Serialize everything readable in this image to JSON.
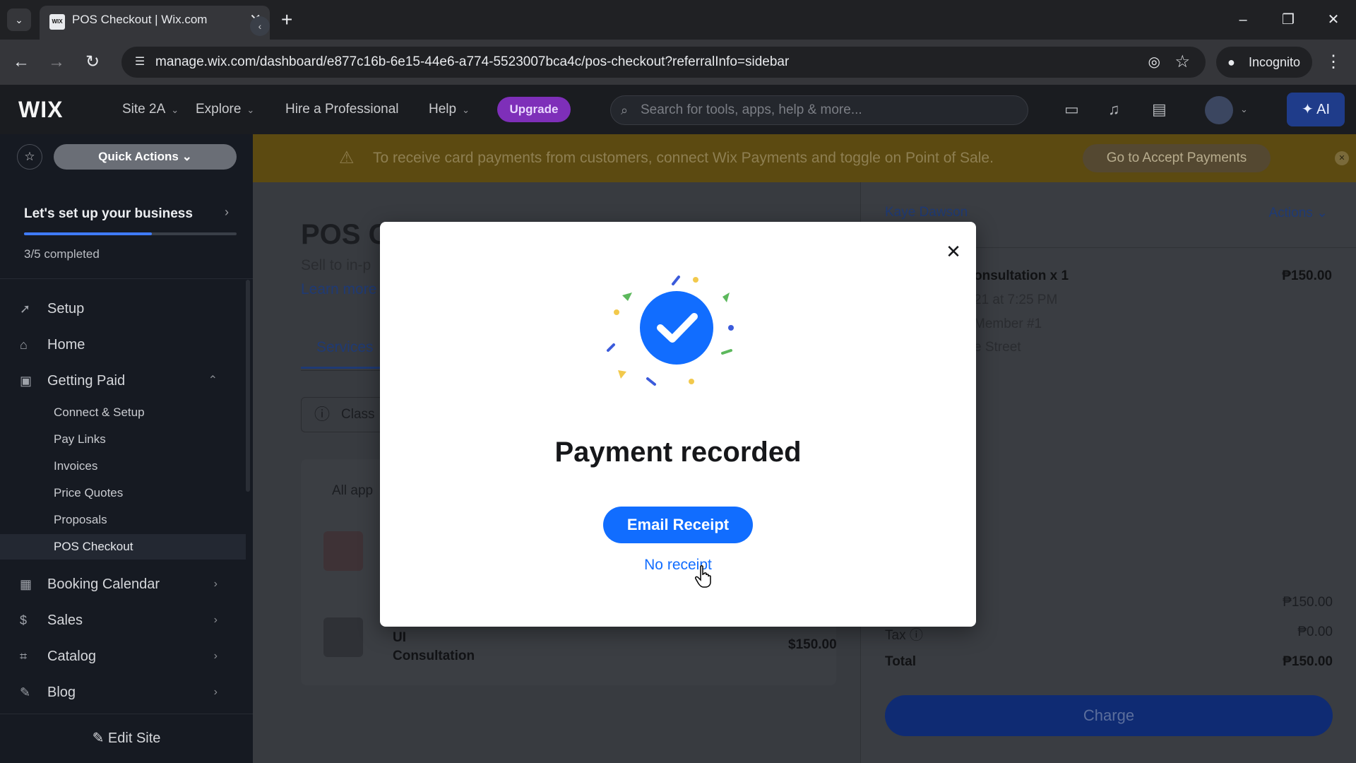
{
  "browser": {
    "tab_title": "POS Checkout | Wix.com",
    "favicon_text": "WIX",
    "url": "manage.wix.com/dashboard/e877c16b-6e15-44e6-a774-5523007bca4c/pos-checkout?referralInfo=sidebar",
    "incognito_label": "Incognito"
  },
  "topbar": {
    "logo": "WIX",
    "site_name": "Site 2A",
    "explore": "Explore",
    "hire": "Hire a Professional",
    "help": "Help",
    "upgrade": "Upgrade",
    "search_placeholder": "Search for tools, apps, help & more...",
    "ai_label": "AI"
  },
  "sidebar": {
    "quick_actions": "Quick Actions",
    "setup_title": "Let's set up your business",
    "progress_completed": 3,
    "progress_total": 5,
    "progress_text": "3/5 completed",
    "items": [
      {
        "label": "Setup",
        "icon": "rocket-icon"
      },
      {
        "label": "Home",
        "icon": "home-icon"
      },
      {
        "label": "Getting Paid",
        "icon": "payment-icon"
      }
    ],
    "sub_items": [
      "Connect & Setup",
      "Pay Links",
      "Invoices",
      "Price Quotes",
      "Proposals",
      "POS Checkout"
    ],
    "active_sub_item": "POS Checkout",
    "items_after": [
      {
        "label": "Booking Calendar",
        "icon": "calendar-icon"
      },
      {
        "label": "Sales",
        "icon": "dollar-icon"
      },
      {
        "label": "Catalog",
        "icon": "tag-icon"
      },
      {
        "label": "Blog",
        "icon": "pen-icon"
      }
    ],
    "edit_site": "Edit Site"
  },
  "banner": {
    "text": "To receive card payments from customers, connect Wix Payments and toggle on Point of Sale.",
    "button": "Go to Accept Payments"
  },
  "page": {
    "title_visible": "POS C",
    "subtitle_visible": "Sell to in-p",
    "learn_visible": "Learn more",
    "tab_visible": "Services",
    "info_visible": "Class",
    "list_header_visible": "All app",
    "row2_title_line1": "UI",
    "row2_title_line2": "Consultation",
    "row2_price": "$150.00"
  },
  "order": {
    "customer": "Kaye Dawson",
    "actions": "Actions",
    "item_name_visible": "onsultation x 1",
    "item_price": "₱150.00",
    "item_meta": [
      "21 at 7:25 PM",
      "Member #1",
      "e Street"
    ],
    "subtotal_value": "₱150.00",
    "tax_label": "Tax",
    "tax_value": "₱0.00",
    "total_label": "Total",
    "total_value": "₱150.00",
    "charge": "Charge"
  },
  "modal": {
    "title": "Payment recorded",
    "email_button": "Email Receipt",
    "no_receipt": "No receipt"
  },
  "colors": {
    "accent": "#116dff",
    "upgrade": "#7e2fb9",
    "banner": "#5c4a11"
  }
}
